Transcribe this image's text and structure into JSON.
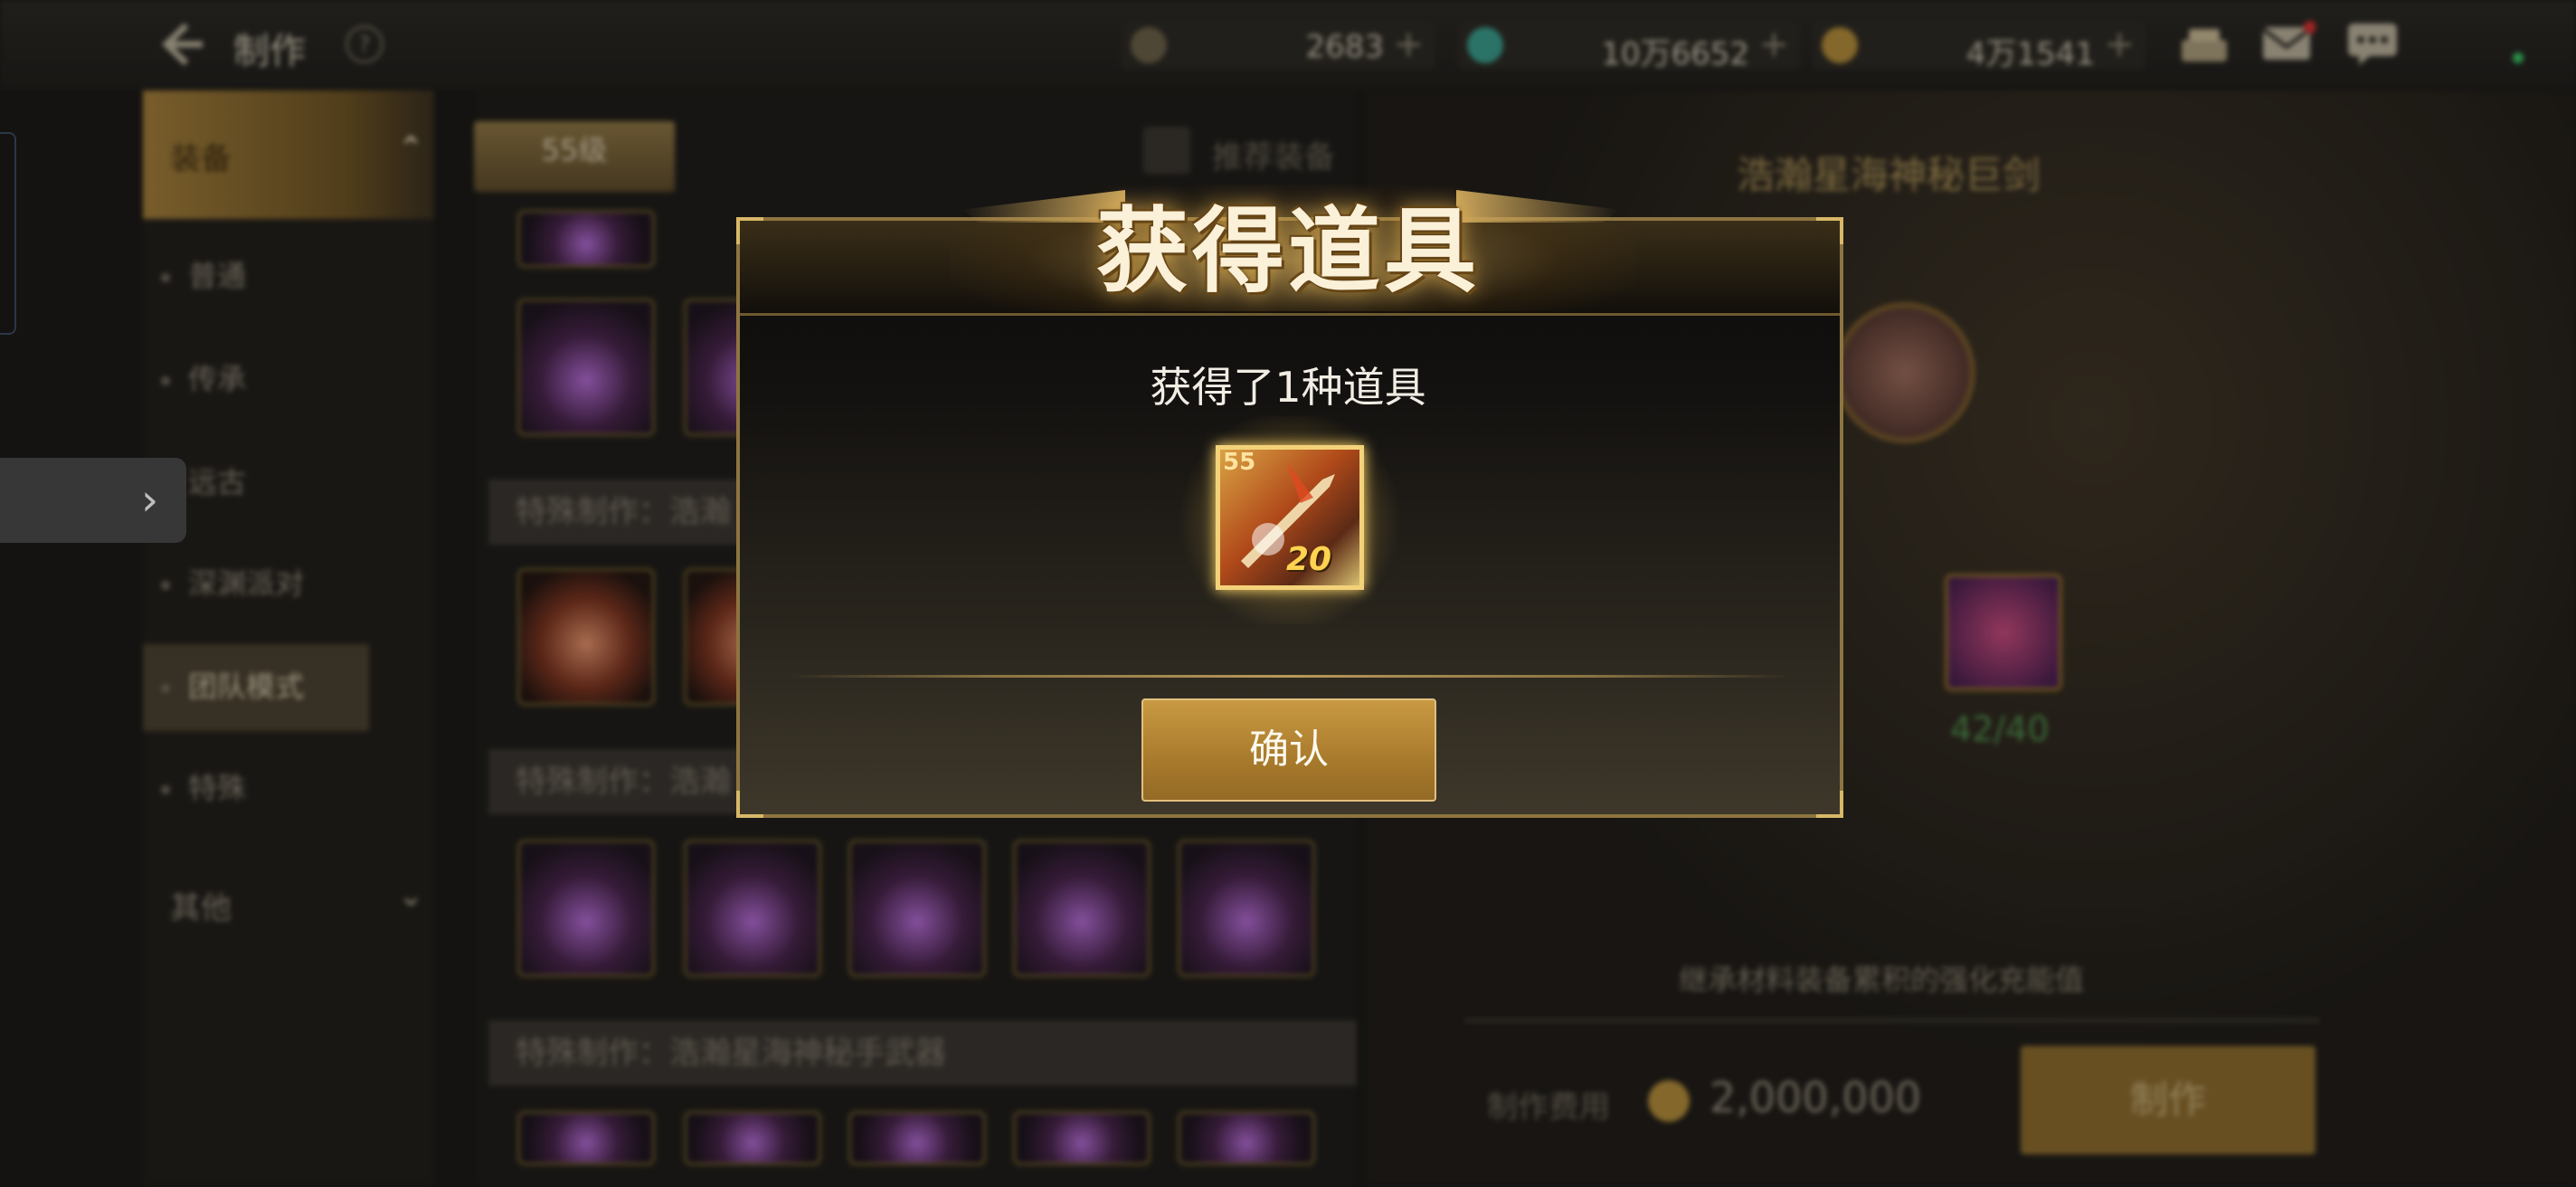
{
  "header": {
    "title": "制作",
    "help_label": "?",
    "currencies": [
      {
        "name": "moon-currency",
        "value": "2683",
        "plus": "+",
        "color": "#8a7a5a"
      },
      {
        "name": "crystal-currency",
        "value": "10万6652",
        "plus": "+",
        "color": "#3a9a8a"
      },
      {
        "name": "gold-currency",
        "value": "4万1541",
        "plus": "+",
        "color": "#b08a3a"
      }
    ]
  },
  "sidebar": {
    "category_equipment": "装备",
    "items": [
      "普通",
      "传承",
      "远古",
      "深渊派对",
      "团队模式",
      "特殊"
    ],
    "category_other": "其他"
  },
  "center": {
    "level_tab": "55级",
    "recommend_label": "推荐装备",
    "sections": [
      "特殊制作：浩瀚",
      "特殊制作：浩瀚",
      "特殊制作：浩瀚星海神秘手武器"
    ]
  },
  "right": {
    "item_name": "浩瀚星海神秘巨剑",
    "material_count": "42/40",
    "description": "继承材料装备累积的强化充能值",
    "cost_label": "制作费用",
    "cost_value": "2,000,000",
    "make_button": "制作"
  },
  "modal": {
    "title": "获得道具",
    "subtitle": "获得了1种道具",
    "reward": {
      "level_label": "55",
      "count": "20"
    },
    "confirm_button": "确认"
  }
}
